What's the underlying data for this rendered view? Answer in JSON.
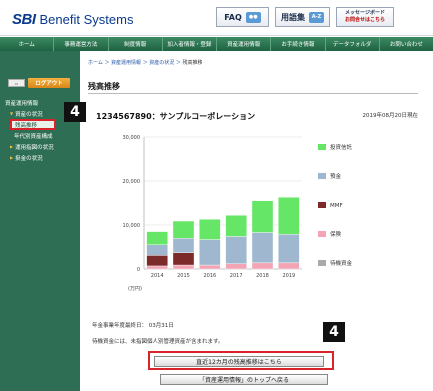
{
  "header": {
    "logo_sbi": "SBI",
    "logo_text": "Benefit Systems",
    "faq_label": "FAQ",
    "glossary_label": "用語集",
    "glossary_icon_text": "A-Z",
    "message_board_line1": "メッセージボード",
    "message_board_line2": "お問合せはこちら"
  },
  "nav": {
    "items": [
      "ホーム",
      "事務運営方法",
      "制度情報",
      "加入者情報・登録",
      "資産運用情報",
      "お手続き情報",
      "データフォルダ",
      "お問い合わせ"
    ]
  },
  "sidebar": {
    "logout_label": "ログアウト",
    "items": [
      {
        "label": "資産運用情報",
        "level": 0
      },
      {
        "label": "資産の状況",
        "level": 1
      },
      {
        "label": "残高推移",
        "level": 2,
        "active": true
      },
      {
        "label": "年代別資産構成",
        "level": 2
      },
      {
        "label": "運用指図の状況",
        "level": 1
      },
      {
        "label": "掛金の状況",
        "level": 1
      }
    ]
  },
  "badges": {
    "sidebar_badge": "4",
    "button_badge": "4"
  },
  "main": {
    "breadcrumb": [
      "ホーム",
      "資産運用情報",
      "資産の状況",
      "残高推移"
    ],
    "page_title": "残高推移",
    "company": "1234567890：サンプルコーポレーション",
    "as_of": "2019年08月20日現在",
    "note1": "年金事業年度最終日： 03月31日",
    "note2": "待機資金には、未指図個人別管理資産が含まれます。",
    "button_recent": "直近12カ月の残高推移はこちら",
    "button_back": "「資産運用情報」のトップへ戻る"
  },
  "colors": {
    "investment_trust": "#66e666",
    "deposit": "#9fb8cf",
    "mmf": "#7d2a2a",
    "insurance": "#f3a5b5",
    "standby": "#aaaaaa",
    "nav_green": "#2e7a55",
    "highlight_red": "#d8232a"
  },
  "chart_data": {
    "type": "bar",
    "stacked": true,
    "categories": [
      "2014",
      "2015",
      "2016",
      "2017",
      "2018",
      "2019"
    ],
    "series": [
      {
        "name": "待機資金",
        "values": [
          0,
          0,
          0,
          0,
          0,
          0
        ]
      },
      {
        "name": "保険",
        "values": [
          700,
          900,
          900,
          1200,
          1400,
          1400
        ]
      },
      {
        "name": "MMF",
        "values": [
          2400,
          2800,
          0,
          0,
          0,
          0
        ]
      },
      {
        "name": "預金",
        "values": [
          2400,
          3300,
          5800,
          6200,
          6900,
          6500
        ]
      },
      {
        "name": "投資信託",
        "values": [
          3000,
          3900,
          4600,
          4800,
          7200,
          8400
        ]
      }
    ],
    "legend_order": [
      "投資信託",
      "預金",
      "MMF",
      "保険",
      "待機資金"
    ],
    "ylim": [
      0,
      30000
    ],
    "yticks": [
      "0",
      "10,000",
      "20,000",
      "30,000"
    ],
    "unit_label": "(万円)",
    "grid": true,
    "legend_position": "right"
  }
}
